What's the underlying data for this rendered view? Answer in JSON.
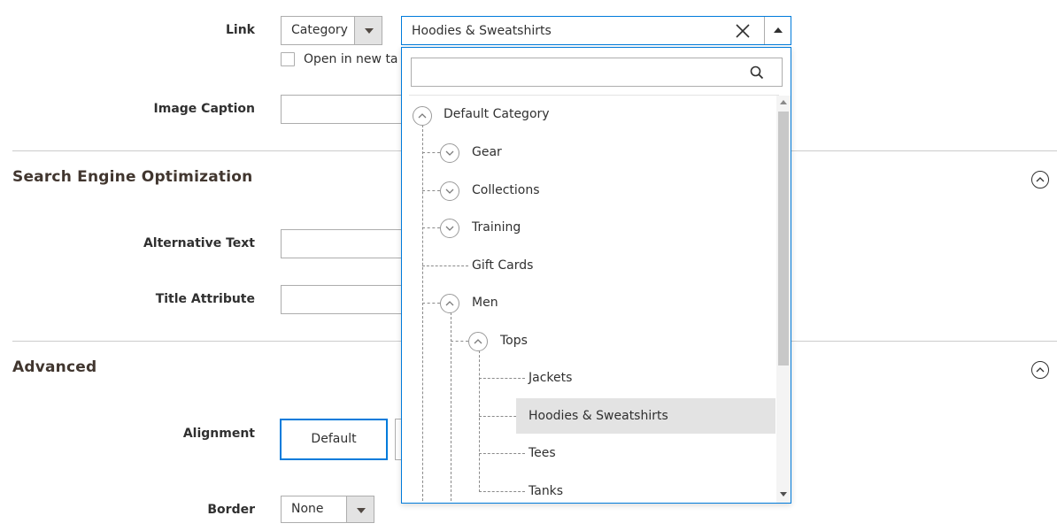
{
  "link": {
    "label": "Link",
    "type_value": "Category",
    "selected_value": "Hoodies & Sweatshirts",
    "open_new_tab_label": "Open in new tab"
  },
  "image_caption": {
    "label": "Image Caption",
    "value": ""
  },
  "seo": {
    "title": "Search Engine Optimization",
    "alt_text_label": "Alternative Text",
    "alt_text_value": "",
    "title_attr_label": "Title Attribute",
    "title_attr_value": ""
  },
  "advanced": {
    "title": "Advanced",
    "alignment_label": "Alignment",
    "alignment_value": "Default",
    "border_label": "Border",
    "border_value": "None"
  },
  "dropdown": {
    "search_placeholder": "",
    "tree": [
      {
        "label": "Default Category",
        "toggle": "expanded"
      },
      {
        "label": "Gear",
        "toggle": "collapsed"
      },
      {
        "label": "Collections",
        "toggle": "collapsed"
      },
      {
        "label": "Training",
        "toggle": "collapsed"
      },
      {
        "label": "Gift Cards",
        "toggle": "none"
      },
      {
        "label": "Men",
        "toggle": "expanded"
      },
      {
        "label": "Tops",
        "toggle": "expanded"
      },
      {
        "label": "Jackets",
        "toggle": "none"
      },
      {
        "label": "Hoodies & Sweatshirts",
        "toggle": "none",
        "selected": true
      },
      {
        "label": "Tees",
        "toggle": "none"
      },
      {
        "label": "Tanks",
        "toggle": "none"
      }
    ],
    "scroll_position_fraction": 0.0
  },
  "colors": {
    "accent": "#007bdb",
    "selected_row": "#e3e3e3",
    "border": "#adadad",
    "text": "#303030"
  },
  "icons": {
    "clear": "close-icon",
    "search": "search-icon",
    "section_toggle": "chevron-up-circle-icon",
    "node_expanded": "chevron-up-circle-icon",
    "node_collapsed": "chevron-down-circle-icon"
  }
}
